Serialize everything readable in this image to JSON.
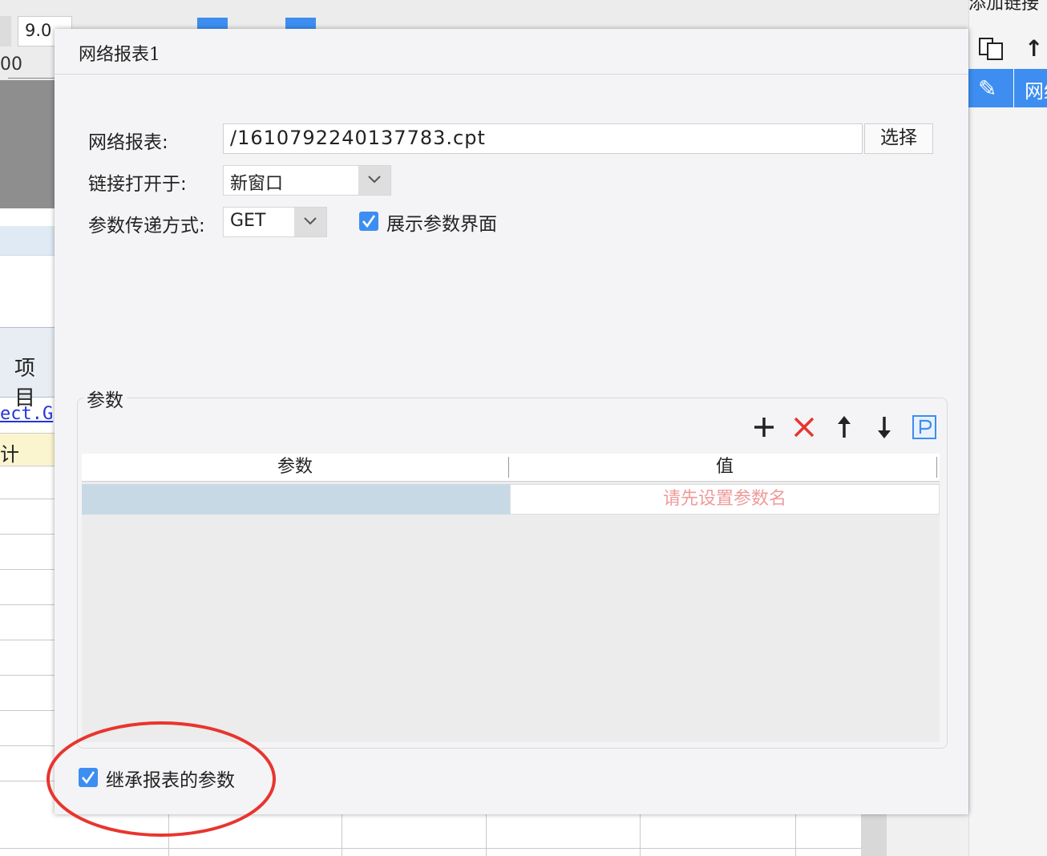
{
  "toolbar": {
    "font_size": "9.0"
  },
  "ruler": {
    "value": "00"
  },
  "sheet": {
    "header_cell": "项目",
    "link_cell": "ect.G",
    "yellow_cell": "计"
  },
  "right_panel": {
    "title": "添加链接",
    "row_label": "网络"
  },
  "dialog": {
    "title": "网络报表1",
    "report_label": "网络报表:",
    "report_path": "/1610792240137783.cpt",
    "select_label": "选择",
    "open_in_label": "链接打开于:",
    "open_in_value": "新窗口",
    "method_label": "参数传递方式:",
    "method_value": "GET",
    "show_params_label": "展示参数界面",
    "show_params_checked": true,
    "params_group_label": "参数",
    "table": {
      "columns": [
        "参数",
        "值"
      ],
      "rows": [
        {
          "param": "",
          "value_placeholder": "请先设置参数名"
        }
      ]
    },
    "inherit_label": "继承报表的参数",
    "inherit_checked": true
  },
  "colors": {
    "accent": "#3d8ef0",
    "delete_red": "#e8352e",
    "annotation_red": "#e8352e",
    "selected_cell": "#c8d9e6",
    "placeholder_text": "#f09a9a"
  }
}
